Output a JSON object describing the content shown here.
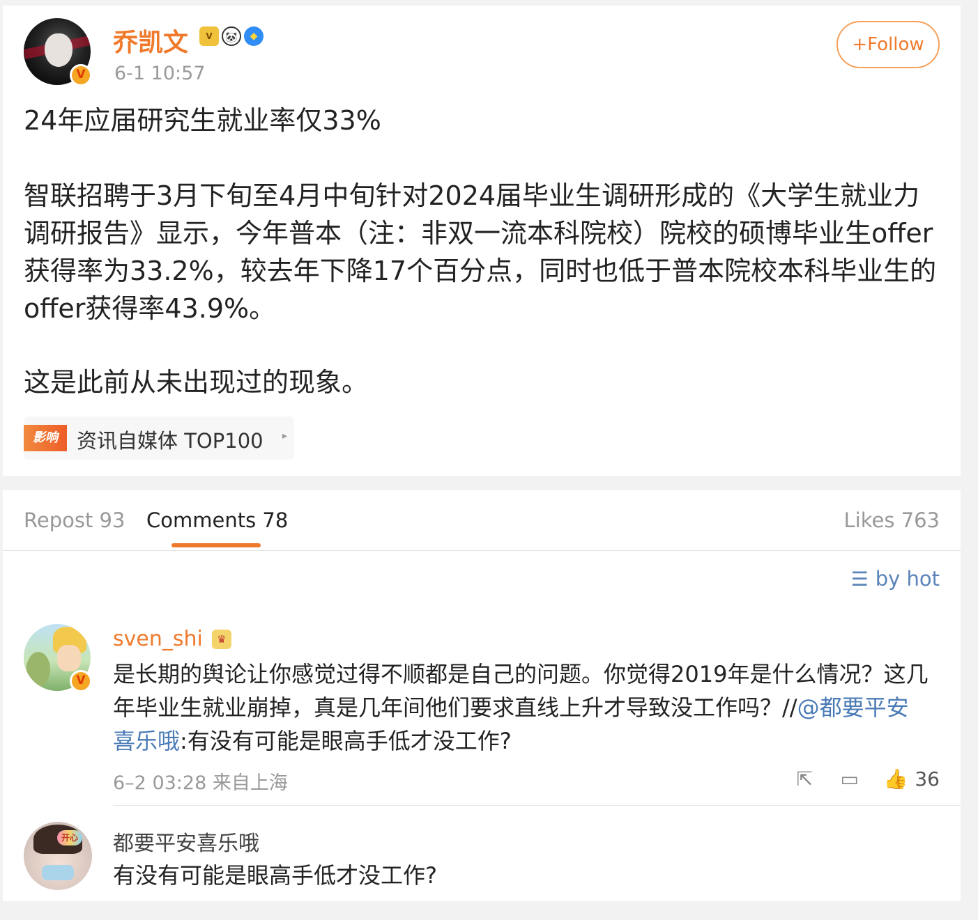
{
  "post": {
    "author": {
      "name": "乔凯文",
      "verified_badge": "V",
      "badges": [
        "level-badge-icon",
        "panda-icon",
        "verified-diamond-icon"
      ]
    },
    "time": "6-1 10:57",
    "follow_label": "+Follow",
    "headline": "24年应届研究生就业率仅33%",
    "body": "智联招聘于3月下旬至4月中旬针对2024届毕业生调研形成的《大学生就业力调研报告》显示，今年普本（注：非双一流本科院校）院校的硕博毕业生offer获得率为33.2%，较去年下降17个百分点，同时也低于普本院校本科毕业生的offer获得率43.9%。",
    "ending": "这是此前从未出现过的现象。",
    "tag": {
      "icon_text": "影响",
      "label": "资讯自媒体 TOP100",
      "arrow": "▸"
    }
  },
  "tabs": {
    "repost": "Repost 93",
    "comments": "Comments 78",
    "likes": "Likes 763"
  },
  "sort": {
    "icon": "☰",
    "label": "by hot"
  },
  "comments": [
    {
      "name": "sven_shi",
      "crown_icon": "♛",
      "text_before": "是长期的舆论让你感觉过得不顺都是自己的问题。你觉得2019年是什么情况？这几年毕业生就业崩掉，真是几年间他们要求直线上升才导致没工作吗？//",
      "mention": "@都要平安喜乐哦",
      "text_after": ":有没有可能是眼高手低才没工作?",
      "meta": "6–2 03:28 来自上海",
      "share_icon": "⇱",
      "reply_icon": "▭",
      "like_icon": "👍",
      "like_count": "36"
    },
    {
      "name": "都要平安喜乐哦",
      "text": "有没有可能是眼高手低才没工作?",
      "sticker_text": "开心"
    }
  ],
  "colors": {
    "accent_orange": "#ef7a2c",
    "link_blue": "#4a7bb7",
    "muted_gray": "#999999"
  }
}
